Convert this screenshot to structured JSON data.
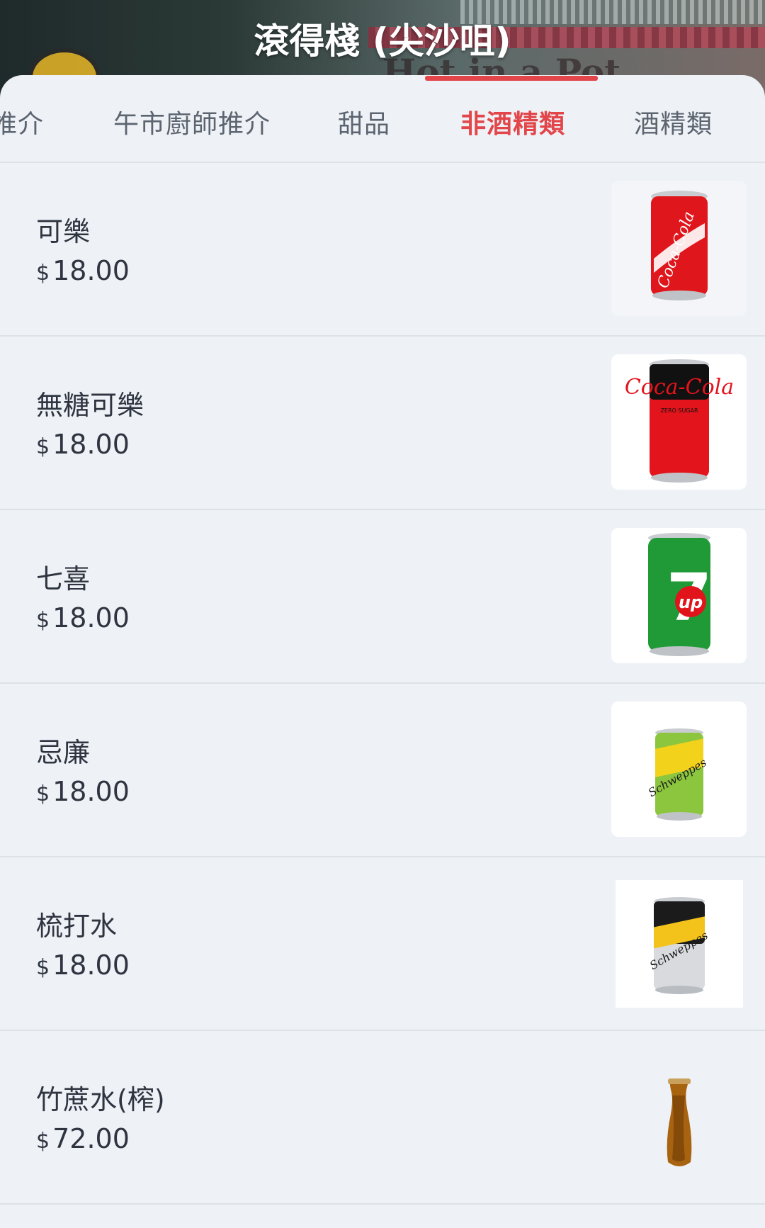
{
  "header": {
    "title": "滾得棧 (尖沙咀)",
    "banner_text": "Hot in a Pot"
  },
  "tabs": [
    {
      "label": "推介",
      "active": false
    },
    {
      "label": "午市廚師推介",
      "active": false
    },
    {
      "label": "甜品",
      "active": false
    },
    {
      "label": "非酒精類",
      "active": true
    },
    {
      "label": "酒精類",
      "active": false
    }
  ],
  "items": [
    {
      "name": "可樂",
      "currency": "$",
      "price": "18.00",
      "image": "coca-cola-can"
    },
    {
      "name": "無糖可樂",
      "currency": "$",
      "price": "18.00",
      "image": "coke-zero-can"
    },
    {
      "name": "七喜",
      "currency": "$",
      "price": "18.00",
      "image": "7up-can"
    },
    {
      "name": "忌廉",
      "currency": "$",
      "price": "18.00",
      "image": "schweppes-cream-soda-can"
    },
    {
      "name": "梳打水",
      "currency": "$",
      "price": "18.00",
      "image": "schweppes-soda-water-can"
    },
    {
      "name": "竹蔗水(榨)",
      "currency": "$",
      "price": "72.00",
      "image": "sugarcane-juice-jug"
    }
  ],
  "colors": {
    "accent": "#e2464a",
    "background": "#eef2f6",
    "text": "#2e3440",
    "tab_inactive": "#5c6470"
  }
}
